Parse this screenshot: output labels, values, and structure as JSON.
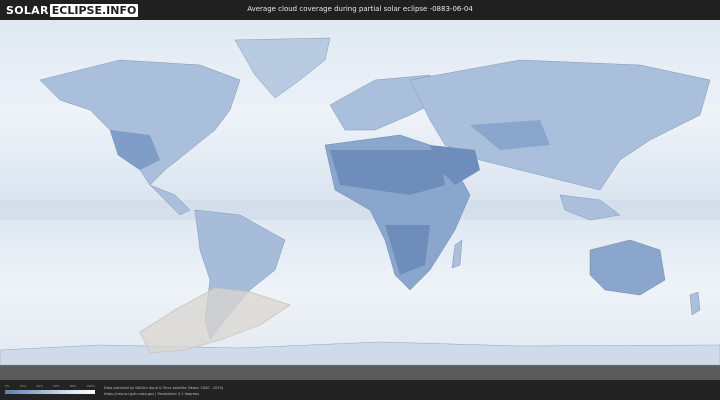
{
  "header": {
    "logo_part1": "SOLAR",
    "logo_part2": "ECLIPSE.INFO",
    "title": "Average cloud coverage during partial solar eclipse -0883-06-04"
  },
  "legend": {
    "ticks": [
      "0%",
      "20%",
      "40%",
      "60%",
      "80%",
      "100%"
    ],
    "colors": {
      "low": "#5d7eaf",
      "mid": "#9fb7d6",
      "high": "#ffffff"
    }
  },
  "credits": {
    "line1": "Data provided by NASA's Aqua & Terra satellite (Years: 2000 - 2019)",
    "line2": "https://neo.sci.gsfc.nasa.gov | Resolution: 0.1 degrees"
  },
  "map": {
    "eclipse_zone_color": "#d9d6d0",
    "ocean_color": "#eef3f8",
    "land_color": "#9db4d2"
  }
}
